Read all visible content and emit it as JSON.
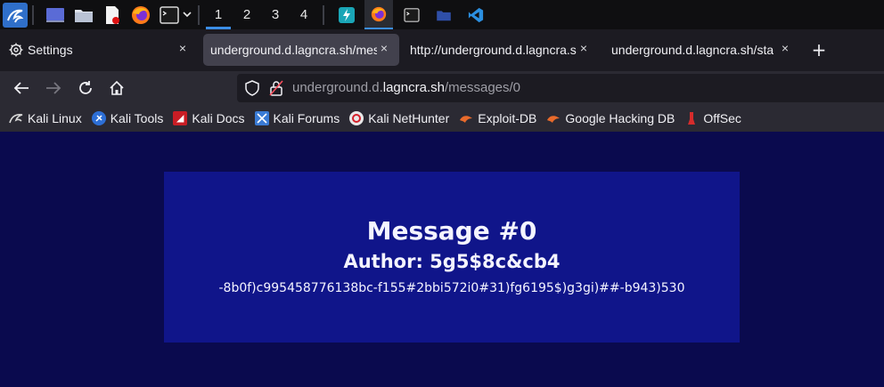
{
  "taskbar": {
    "workspaces": [
      "1",
      "2",
      "3",
      "4"
    ]
  },
  "tabs": [
    {
      "label": "Settings",
      "close": "×"
    },
    {
      "label": "underground.d.lagncra.sh/mess",
      "close": "×"
    },
    {
      "label": "http://underground.d.lagncra.sh",
      "close": "×"
    },
    {
      "label": "underground.d.lagncra.sh/sta",
      "close": "×"
    }
  ],
  "newtab_label": "+",
  "urlbar": {
    "prefix": "underground.d.",
    "host": "lagncra.sh",
    "path": "/messages/0"
  },
  "bookmarks": [
    {
      "label": "Kali Linux",
      "icon": "kali-dragon-icon"
    },
    {
      "label": "Kali Tools",
      "icon": "kali-tools-icon"
    },
    {
      "label": "Kali Docs",
      "icon": "kali-docs-icon"
    },
    {
      "label": "Kali Forums",
      "icon": "kali-forums-icon"
    },
    {
      "label": "Kali NetHunter",
      "icon": "nethunter-icon"
    },
    {
      "label": "Exploit-DB",
      "icon": "exploit-db-icon"
    },
    {
      "label": "Google Hacking DB",
      "icon": "ghdb-icon"
    },
    {
      "label": "OffSec",
      "icon": "offsec-icon"
    }
  ],
  "message": {
    "title": "Message #0",
    "author": "Author: 5g5$8c&cb4",
    "body": "-8b0f)c995458776138bc-f155#2bbi572i0#31)fg6195$)g3gi)##-b943)530"
  },
  "colors": {
    "page_bg": "#0a0a4e",
    "card_bg": "#10158a",
    "accent": "#3b8ee6"
  }
}
